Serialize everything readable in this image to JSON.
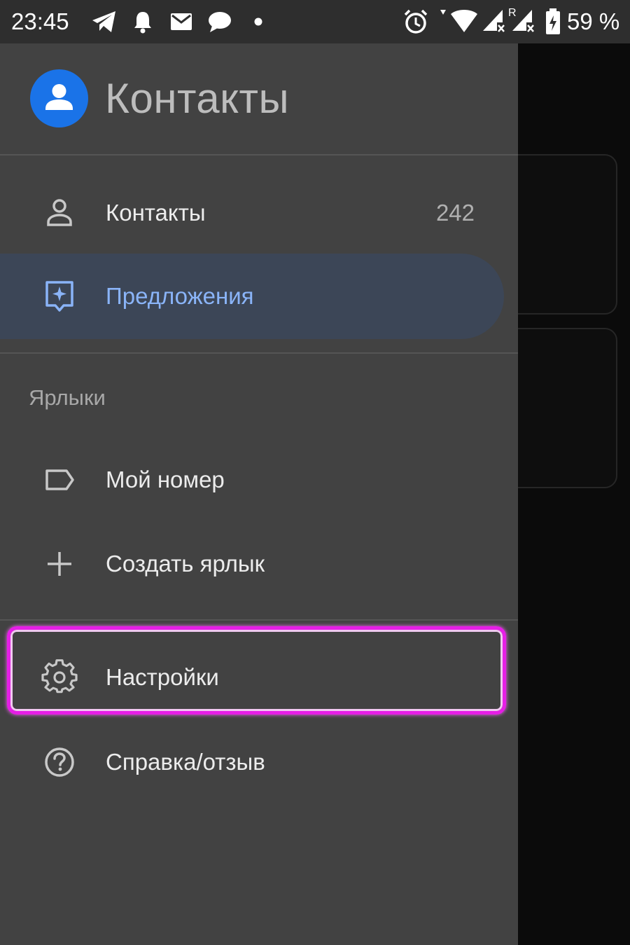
{
  "status_bar": {
    "time": "23:45",
    "battery_text": "59 %",
    "roaming": "R",
    "icons": [
      "telegram-icon",
      "bell-icon",
      "mail-icon",
      "chat-icon",
      "dot-icon",
      "alarm-icon",
      "wifi-icon",
      "signal-icon",
      "signal-icon",
      "battery-icon"
    ]
  },
  "drawer": {
    "app_title": "Контакты",
    "items": [
      {
        "label": "Контакты",
        "count": "242",
        "icon": "person-icon"
      },
      {
        "label": "Предложения",
        "icon": "suggestions-icon",
        "selected": true
      }
    ],
    "labels_section_title": "Ярлыки",
    "label_items": [
      {
        "label": "Мой номер",
        "icon": "label-icon"
      },
      {
        "label": "Создать ярлык",
        "icon": "plus-icon"
      }
    ],
    "footer_items": [
      {
        "label": "Настройки",
        "icon": "gear-icon",
        "highlighted": true
      },
      {
        "label": "Справка/отзыв",
        "icon": "help-icon"
      }
    ]
  },
  "colors": {
    "drawer_bg": "#424242",
    "accent": "#8ab4f8",
    "selected_bg": "#3c4657",
    "logo": "#1a73e8",
    "highlight": "#e61ee6"
  }
}
